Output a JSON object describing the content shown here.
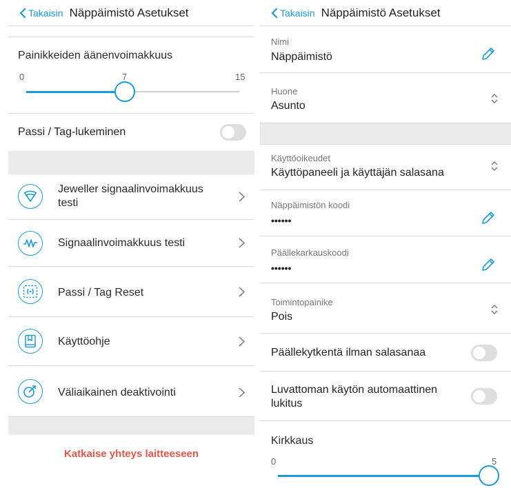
{
  "colors": {
    "accent": "#1a9bd7",
    "danger": "#e2574c",
    "section_gap": "#ebebeb",
    "toggle_off": "#dedede"
  },
  "left": {
    "header": {
      "back_label": "Takaisin",
      "title": "Näppäimistö Asetukset"
    },
    "volume": {
      "title": "Painikkeiden äänenvoimakkuus",
      "min": "0",
      "value": "7",
      "max": "15",
      "level": 7,
      "range_max": 15
    },
    "tag_reading": {
      "label": "Passi / Tag-lukeminen",
      "enabled": false
    },
    "menu": [
      {
        "label": "Jeweller signaalinvoimakkuus testi",
        "icon": "wifi-signal-icon"
      },
      {
        "label": "Signaalinvoimakkuus testi",
        "icon": "waveform-icon"
      },
      {
        "label": "Passi / Tag Reset",
        "icon": "tag-reset-icon"
      },
      {
        "label": "Käyttöohje",
        "icon": "manual-book-icon"
      },
      {
        "label": "Väliaikainen deaktivointi",
        "icon": "deactivate-icon"
      }
    ],
    "disconnect_label": "Katkaise yhteys laitteeseen"
  },
  "right": {
    "header": {
      "back_label": "Takaisin",
      "title": "Näppäimistö Asetukset"
    },
    "name": {
      "label": "Nimi",
      "value": "Näppäimistö"
    },
    "room": {
      "label": "Huone",
      "value": "Asunto"
    },
    "access": {
      "label": "Käyttöoikeudet",
      "value": "Käyttöpaneeli ja käyttäjän salasana"
    },
    "keypad_code": {
      "label": "Näppäimistön koodi",
      "value": "••••••"
    },
    "duress_code": {
      "label": "Päällekarkauskoodi",
      "value": "••••••"
    },
    "function_button": {
      "label": "Toimintopainike",
      "value": "Pois"
    },
    "arm_without_password": {
      "label": "Päällekytkentä ilman salasanaa",
      "enabled": false
    },
    "auto_lock": {
      "label": "Luvattoman käytön automaattinen lukitus",
      "enabled": false
    },
    "brightness": {
      "title": "Kirkkaus",
      "min": "0",
      "max": "5",
      "level": 5,
      "range_max": 5
    }
  }
}
